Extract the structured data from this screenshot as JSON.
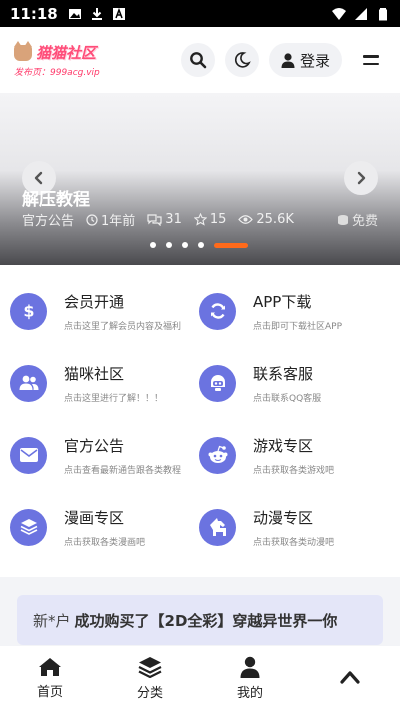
{
  "status_bar": {
    "time": "11:18",
    "icons": [
      "image-icon",
      "download-icon",
      "a-icon",
      "wifi-icon",
      "signal-icon",
      "battery-icon"
    ]
  },
  "header": {
    "logo_title": "猫猫社区",
    "logo_subtitle": "发布页：999acg.vip",
    "login_label": "登录",
    "icons": [
      "search-icon",
      "moon-icon",
      "user-icon",
      "menu-icon"
    ]
  },
  "banner": {
    "title": "解压教程",
    "category": "官方公告",
    "time_ago": "1年前",
    "comments": "31",
    "likes": "15",
    "views": "25.6K",
    "price": "免费",
    "slide_count": 5,
    "active_slide": 5
  },
  "features": [
    {
      "title": "会员开通",
      "desc": "点击这里了解会员内容及福利",
      "icon": "dollar-icon"
    },
    {
      "title": "APP下载",
      "desc": "点击即可下载社区APP",
      "icon": "refresh-icon"
    },
    {
      "title": "猫咪社区",
      "desc": "点击这里进行了解！！！",
      "icon": "users-icon"
    },
    {
      "title": "联系客服",
      "desc": "点击联系QQ客服",
      "icon": "bot-icon"
    },
    {
      "title": "官方公告",
      "desc": "点击查看最新通告跟各类教程",
      "icon": "mail-icon"
    },
    {
      "title": "游戏专区",
      "desc": "点击获取各类游戏吧",
      "icon": "reddit-icon"
    },
    {
      "title": "漫画专区",
      "desc": "点击获取各类漫画吧",
      "icon": "layers-icon"
    },
    {
      "title": "动漫专区",
      "desc": "点击获取各类动漫吧",
      "icon": "horse-icon"
    }
  ],
  "notice": {
    "user": "新*户",
    "message": "成功购买了【2D全彩】穿越异世界一你"
  },
  "bottom_nav": [
    {
      "label": "首页",
      "icon": "home-icon"
    },
    {
      "label": "分类",
      "icon": "layers-icon"
    },
    {
      "label": "我的",
      "icon": "user-icon"
    },
    {
      "label": "",
      "icon": "chevron-up-icon"
    }
  ],
  "colors": {
    "accent": "#6b73e0",
    "logo": "#ff4d79",
    "active_dot": "#ff6a1a",
    "notice_bg": "#e4e6f8"
  }
}
